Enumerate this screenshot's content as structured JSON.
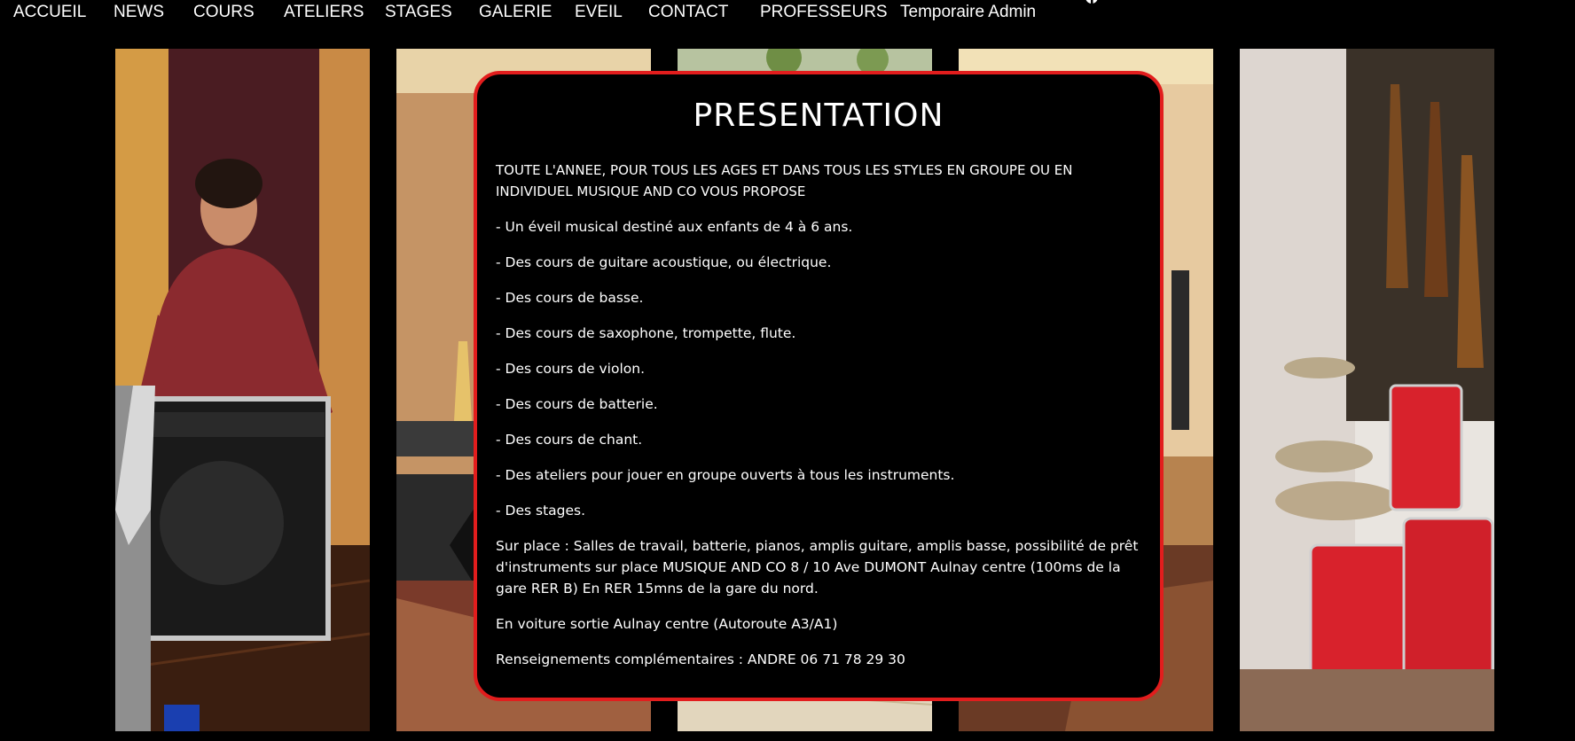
{
  "nav": {
    "items": [
      {
        "label": "ACCUEIL",
        "name": "nav-item-accueil"
      },
      {
        "label": "NEWS",
        "name": "nav-item-news"
      },
      {
        "label": "COURS",
        "name": "nav-item-cours"
      },
      {
        "label": "ATELIERS",
        "name": "nav-item-ateliers"
      },
      {
        "label": "STAGES",
        "name": "nav-item-stages"
      },
      {
        "label": "GALERIE",
        "name": "nav-item-galerie"
      },
      {
        "label": "EVEIL",
        "name": "nav-item-eveil"
      },
      {
        "label": "CONTACT",
        "name": "nav-item-contact"
      },
      {
        "label": "PROFESSEURS",
        "name": "nav-item-professeurs"
      },
      {
        "label": "Temporaire Admin",
        "name": "nav-item-temporaire-admin"
      }
    ],
    "social_icon": "facebook-icon"
  },
  "photos": [
    "guitar-teacher-amp",
    "practice-room-guitars",
    "room-window-plant",
    "studio-room",
    "drum-kit-guitars"
  ],
  "presentation": {
    "title": "PRESENTATION",
    "intro": "TOUTE L'ANNEE, POUR TOUS LES AGES ET DANS TOUS LES STYLES EN GROUPE OU EN INDIVIDUEL MUSIQUE AND CO VOUS PROPOSE",
    "items": [
      "- Un éveil musical destiné aux enfants de 4 à 6 ans.",
      "- Des cours de guitare acoustique, ou électrique.",
      "- Des cours de basse.",
      "- Des cours de saxophone, trompette, flute.",
      "- Des cours de violon.",
      "- Des cours de batterie.",
      "- Des cours de chant.",
      "- Des ateliers pour jouer en groupe ouverts à tous les instruments.",
      "- Des stages."
    ],
    "sur_place": "Sur place : Salles de travail, batterie, pianos, amplis guitare, amplis basse, possibilité de prêt d'instruments sur place MUSIQUE AND CO 8 / 10 Ave DUMONT Aulnay centre (100ms de la gare RER B) En RER 15mns de la gare du nord.",
    "voiture": "En voiture sortie Aulnay centre (Autoroute A3/A1)",
    "renseignements": "Renseignements complémentaires : ANDRE 06 71 78 29 30"
  },
  "colors": {
    "background": "#000000",
    "box_border": "#e21d1d",
    "text": "#ffffff"
  }
}
